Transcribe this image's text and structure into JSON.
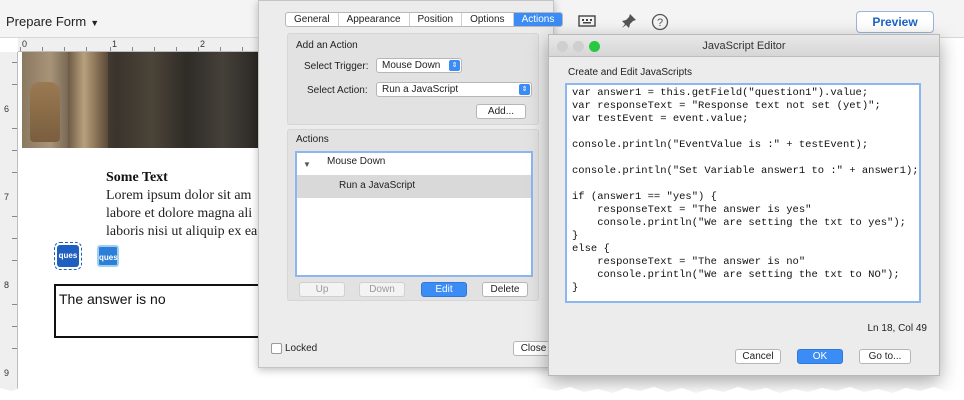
{
  "toolbar": {
    "prepare_form": "Prepare Form",
    "preview_label": "Preview"
  },
  "ruler": {
    "top_labels": [
      "0",
      "1",
      "2"
    ],
    "left_labels": [
      "6",
      "7",
      "8",
      "9"
    ]
  },
  "document": {
    "heading": "Some Text",
    "lorem_lines": [
      "Lorem ipsum dolor sit am",
      "labore et dolore magna ali",
      "laboris nisi ut aliquip ex ea"
    ],
    "question_btn_label": "ques",
    "answer_text": "The answer is no"
  },
  "properties": {
    "tabs": [
      "General",
      "Appearance",
      "Position",
      "Options",
      "Actions"
    ],
    "active_tab": "Actions",
    "add_action_title": "Add an Action",
    "trigger_label": "Select Trigger:",
    "trigger_value": "Mouse Down",
    "action_label": "Select Action:",
    "action_value": "Run a JavaScript",
    "add_button": "Add...",
    "actions_title": "Actions",
    "tree": {
      "parent": "Mouse Down",
      "child": "Run a JavaScript"
    },
    "buttons": {
      "up": "Up",
      "down": "Down",
      "edit": "Edit",
      "delete": "Delete"
    },
    "locked_label": "Locked",
    "close_label": "Close"
  },
  "editor": {
    "title": "JavaScript Editor",
    "subtitle": "Create and Edit JavaScripts",
    "code_lines": [
      "var answer1 = this.getField(\"question1\").value;",
      "var responseText = \"Response text not set (yet)\";",
      "var testEvent = event.value;",
      "",
      "console.println(\"EventValue is :\" + testEvent);",
      "",
      "console.println(\"Set Variable answer1 to :\" + answer1);",
      "",
      "if (answer1 == \"yes\") {",
      "    responseText = \"The answer is yes\"",
      "    console.println(\"We are setting the txt to yes\");",
      "}",
      "else {",
      "    responseText = \"The answer is no\"",
      "    console.println(\"We are setting the txt to NO\");",
      "}"
    ],
    "cursor_position": "Ln 18, Col 49",
    "cancel_label": "Cancel",
    "ok_label": "OK",
    "goto_label": "Go to..."
  },
  "colors": {
    "accent": "#3b8cf4",
    "preview_text": "#1b63c6",
    "traffic_close": "#cfcfcf",
    "traffic_min": "#cfcfcf",
    "traffic_max": "#28c840"
  }
}
